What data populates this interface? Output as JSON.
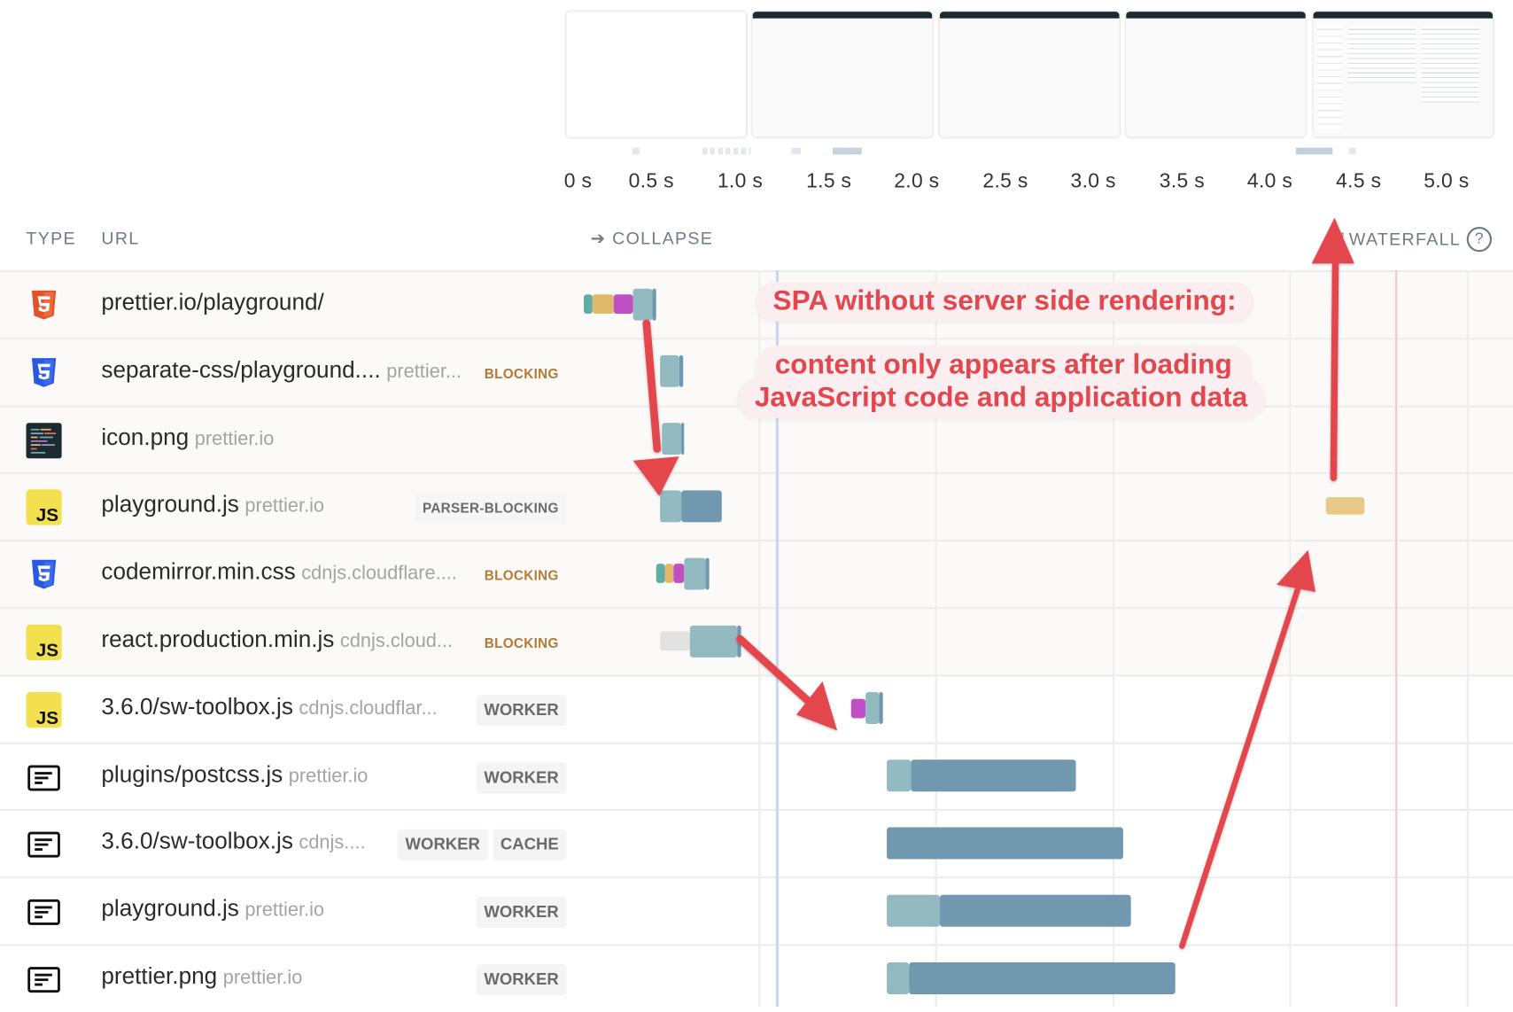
{
  "filmstrip": {
    "frames": [
      {
        "state": "blank"
      },
      {
        "state": "app-shell"
      },
      {
        "state": "app-shell"
      },
      {
        "state": "app-shell"
      },
      {
        "state": "content-rendered"
      }
    ]
  },
  "timeline": {
    "ticks": [
      "0 s",
      "0.5 s",
      "1.0 s",
      "1.5 s",
      "2.0 s",
      "2.5 s",
      "3.0 s",
      "3.5 s",
      "4.0 s",
      "4.5 s",
      "5.0 s"
    ]
  },
  "table_header": {
    "type_label": "TYPE",
    "url_label": "URL",
    "collapse_label": "➔ COLLAPSE",
    "waterfall_label": "WATERFALL",
    "help_icon": "?"
  },
  "colors": {
    "annotation_red": "#e3474d",
    "bar_light": "#93bac1",
    "bar_dark": "#7198ae",
    "dns": "#60ada3",
    "connect": "#e1b96b",
    "ssl": "#c04fc4",
    "blocking_badge": "#b47a36",
    "fcp_line": "#c9d8f0",
    "lcp_line": "#f4c9c4"
  },
  "requests": [
    {
      "type_icon": "html5-icon",
      "url": "prettier.io/playground/",
      "host": "",
      "badges": []
    },
    {
      "type_icon": "css3-icon",
      "url": "separate-css/playground....",
      "host": "prettier...",
      "badges": [
        {
          "label": "BLOCKING",
          "style": "orange"
        }
      ]
    },
    {
      "type_icon": "image-icon",
      "url": "icon.png",
      "host": "prettier.io",
      "badges": []
    },
    {
      "type_icon": "javascript-icon",
      "url": "playground.js",
      "host": "prettier.io",
      "badges": [
        {
          "label": "PARSER-BLOCKING",
          "style": "pb"
        }
      ]
    },
    {
      "type_icon": "css3-icon",
      "url": "codemirror.min.css",
      "host": "cdnjs.cloudflare....",
      "badges": [
        {
          "label": "BLOCKING",
          "style": "orange"
        }
      ]
    },
    {
      "type_icon": "javascript-icon",
      "url": "react.production.min.js",
      "host": "cdnjs.cloud...",
      "badges": [
        {
          "label": "BLOCKING",
          "style": "orange"
        }
      ]
    },
    {
      "type_icon": "javascript-icon",
      "url": "3.6.0/sw-toolbox.js",
      "host": "cdnjs.cloudflar...",
      "badges": [
        {
          "label": "WORKER",
          "style": "gray"
        }
      ]
    },
    {
      "type_icon": "document-icon",
      "url": "plugins/postcss.js",
      "host": "prettier.io",
      "badges": [
        {
          "label": "WORKER",
          "style": "gray"
        }
      ]
    },
    {
      "type_icon": "document-icon",
      "url": "3.6.0/sw-toolbox.js",
      "host": "cdnjs....",
      "badges": [
        {
          "label": "WORKER",
          "style": "gray"
        },
        {
          "label": "CACHE",
          "style": "gray"
        }
      ]
    },
    {
      "type_icon": "document-icon",
      "url": "playground.js",
      "host": "prettier.io",
      "badges": [
        {
          "label": "WORKER",
          "style": "gray"
        }
      ]
    },
    {
      "type_icon": "document-icon",
      "url": "prettier.png",
      "host": "prettier.io",
      "badges": [
        {
          "label": "WORKER",
          "style": "gray"
        }
      ]
    }
  ],
  "waterfall": {
    "unit": "seconds",
    "rows": [
      [
        {
          "start": 0.01,
          "end": 0.06,
          "kind": "dns"
        },
        {
          "start": 0.06,
          "end": 0.18,
          "kind": "connect"
        },
        {
          "start": 0.18,
          "end": 0.29,
          "kind": "ssl"
        },
        {
          "start": 0.29,
          "end": 0.4,
          "kind": "light"
        },
        {
          "start": 0.4,
          "end": 0.42,
          "kind": "dark"
        }
      ],
      [
        {
          "start": 0.44,
          "end": 0.55,
          "kind": "light"
        },
        {
          "start": 0.55,
          "end": 0.57,
          "kind": "dark"
        }
      ],
      [
        {
          "start": 0.45,
          "end": 0.56,
          "kind": "light"
        },
        {
          "start": 0.56,
          "end": 0.58,
          "kind": "dark"
        }
      ],
      [
        {
          "start": 0.44,
          "end": 0.56,
          "kind": "light"
        },
        {
          "start": 0.56,
          "end": 0.79,
          "kind": "dark"
        }
      ],
      [
        {
          "start": 0.42,
          "end": 0.47,
          "kind": "dns"
        },
        {
          "start": 0.47,
          "end": 0.52,
          "kind": "connect"
        },
        {
          "start": 0.52,
          "end": 0.58,
          "kind": "ssl"
        },
        {
          "start": 0.58,
          "end": 0.7,
          "kind": "light"
        },
        {
          "start": 0.7,
          "end": 0.72,
          "kind": "dark"
        }
      ],
      [
        {
          "start": 0.44,
          "end": 0.61,
          "kind": "wait"
        },
        {
          "start": 0.61,
          "end": 0.88,
          "kind": "light"
        },
        {
          "start": 0.88,
          "end": 0.9,
          "kind": "dark"
        }
      ],
      [
        {
          "start": 1.52,
          "end": 1.6,
          "kind": "ssl"
        },
        {
          "start": 1.6,
          "end": 1.68,
          "kind": "light"
        },
        {
          "start": 1.68,
          "end": 1.7,
          "kind": "dark"
        }
      ],
      [
        {
          "start": 1.72,
          "end": 1.86,
          "kind": "light"
        },
        {
          "start": 1.86,
          "end": 2.79,
          "kind": "dark"
        }
      ],
      [
        {
          "start": 1.72,
          "end": 3.06,
          "kind": "dark"
        }
      ],
      [
        {
          "start": 1.72,
          "end": 2.02,
          "kind": "light"
        },
        {
          "start": 2.02,
          "end": 3.1,
          "kind": "dark"
        }
      ],
      [
        {
          "start": 1.72,
          "end": 1.85,
          "kind": "light"
        },
        {
          "start": 1.85,
          "end": 3.35,
          "kind": "dark"
        }
      ]
    ],
    "extra_bar": {
      "row": 3,
      "start": 4.2,
      "end": 4.42,
      "color": "#e8c988"
    },
    "fcp_marker_s": 1.1,
    "lcp_marker_s": 4.6
  },
  "annotations": {
    "title": "SPA without server side rendering:",
    "line1": "content only appears after loading",
    "line2": "JavaScript code and application data"
  }
}
